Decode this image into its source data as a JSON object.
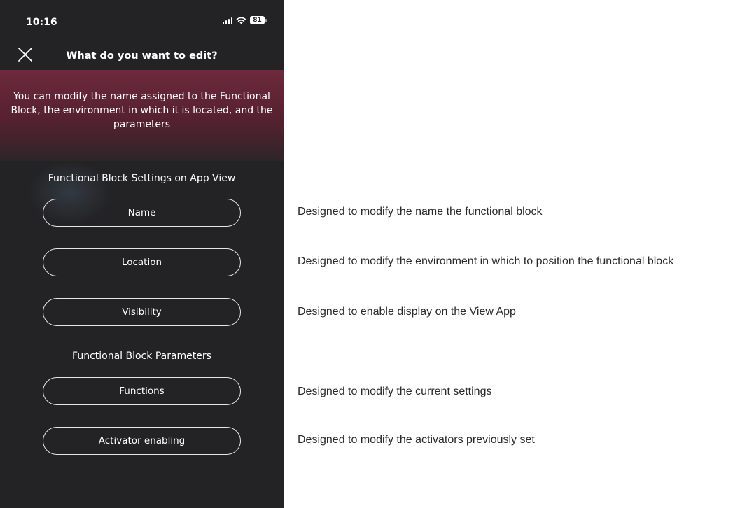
{
  "status_bar": {
    "time": "10:16",
    "battery": "81",
    "icons": [
      "signal-icon",
      "wifi-icon",
      "battery-icon"
    ]
  },
  "nav": {
    "title": "What do you want to edit?",
    "close_icon": "close-icon"
  },
  "banner": {
    "text": "You can modify the name assigned to the Functional Block, the environment in which it is located, and the parameters"
  },
  "sections": {
    "app_view_title": "Functional Block Settings on App View",
    "parameters_title": "Functional Block Parameters"
  },
  "buttons": {
    "name": "Name",
    "location": "Location",
    "visibility": "Visibility",
    "functions": "Functions",
    "activator_enabling": "Activator enabling"
  },
  "descriptions": {
    "name": "Designed to modify the name the functional block",
    "location": "Designed to modify the environment in which to position the functional block",
    "visibility": "Designed to enable display on the View App",
    "functions": "Designed to modify the current settings",
    "activator_enabling": "Designed to modify the activators previously set"
  },
  "colors": {
    "phone_background": "#232325",
    "banner_top": "#6d2a3c",
    "banner_bottom": "#2e2529",
    "button_border": "#e6e6e6",
    "description_text": "#2a2a2a"
  }
}
